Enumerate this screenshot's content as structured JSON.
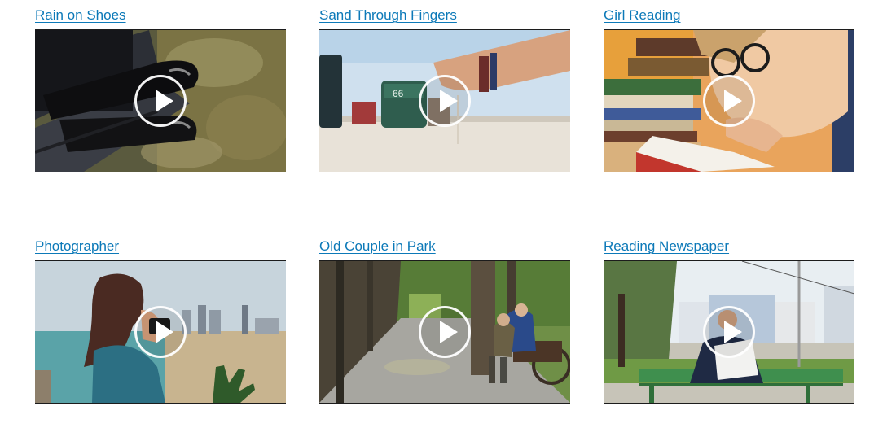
{
  "videos": [
    {
      "title": "Rain on Shoes",
      "thumbnail_icon": "rain-shoes-thumbnail"
    },
    {
      "title": "Sand Through Fingers",
      "thumbnail_icon": "sand-fingers-thumbnail"
    },
    {
      "title": "Girl Reading",
      "thumbnail_icon": "girl-reading-thumbnail"
    },
    {
      "title": "Photographer",
      "thumbnail_icon": "photographer-thumbnail"
    },
    {
      "title": "Old Couple in Park",
      "thumbnail_icon": "old-couple-thumbnail"
    },
    {
      "title": "Reading Newspaper",
      "thumbnail_icon": "newspaper-thumbnail"
    }
  ],
  "thumb_text": {
    "beach_chair_number": "66"
  },
  "colors": {
    "link": "#0c79b8",
    "play_icon": "#ffffff"
  }
}
